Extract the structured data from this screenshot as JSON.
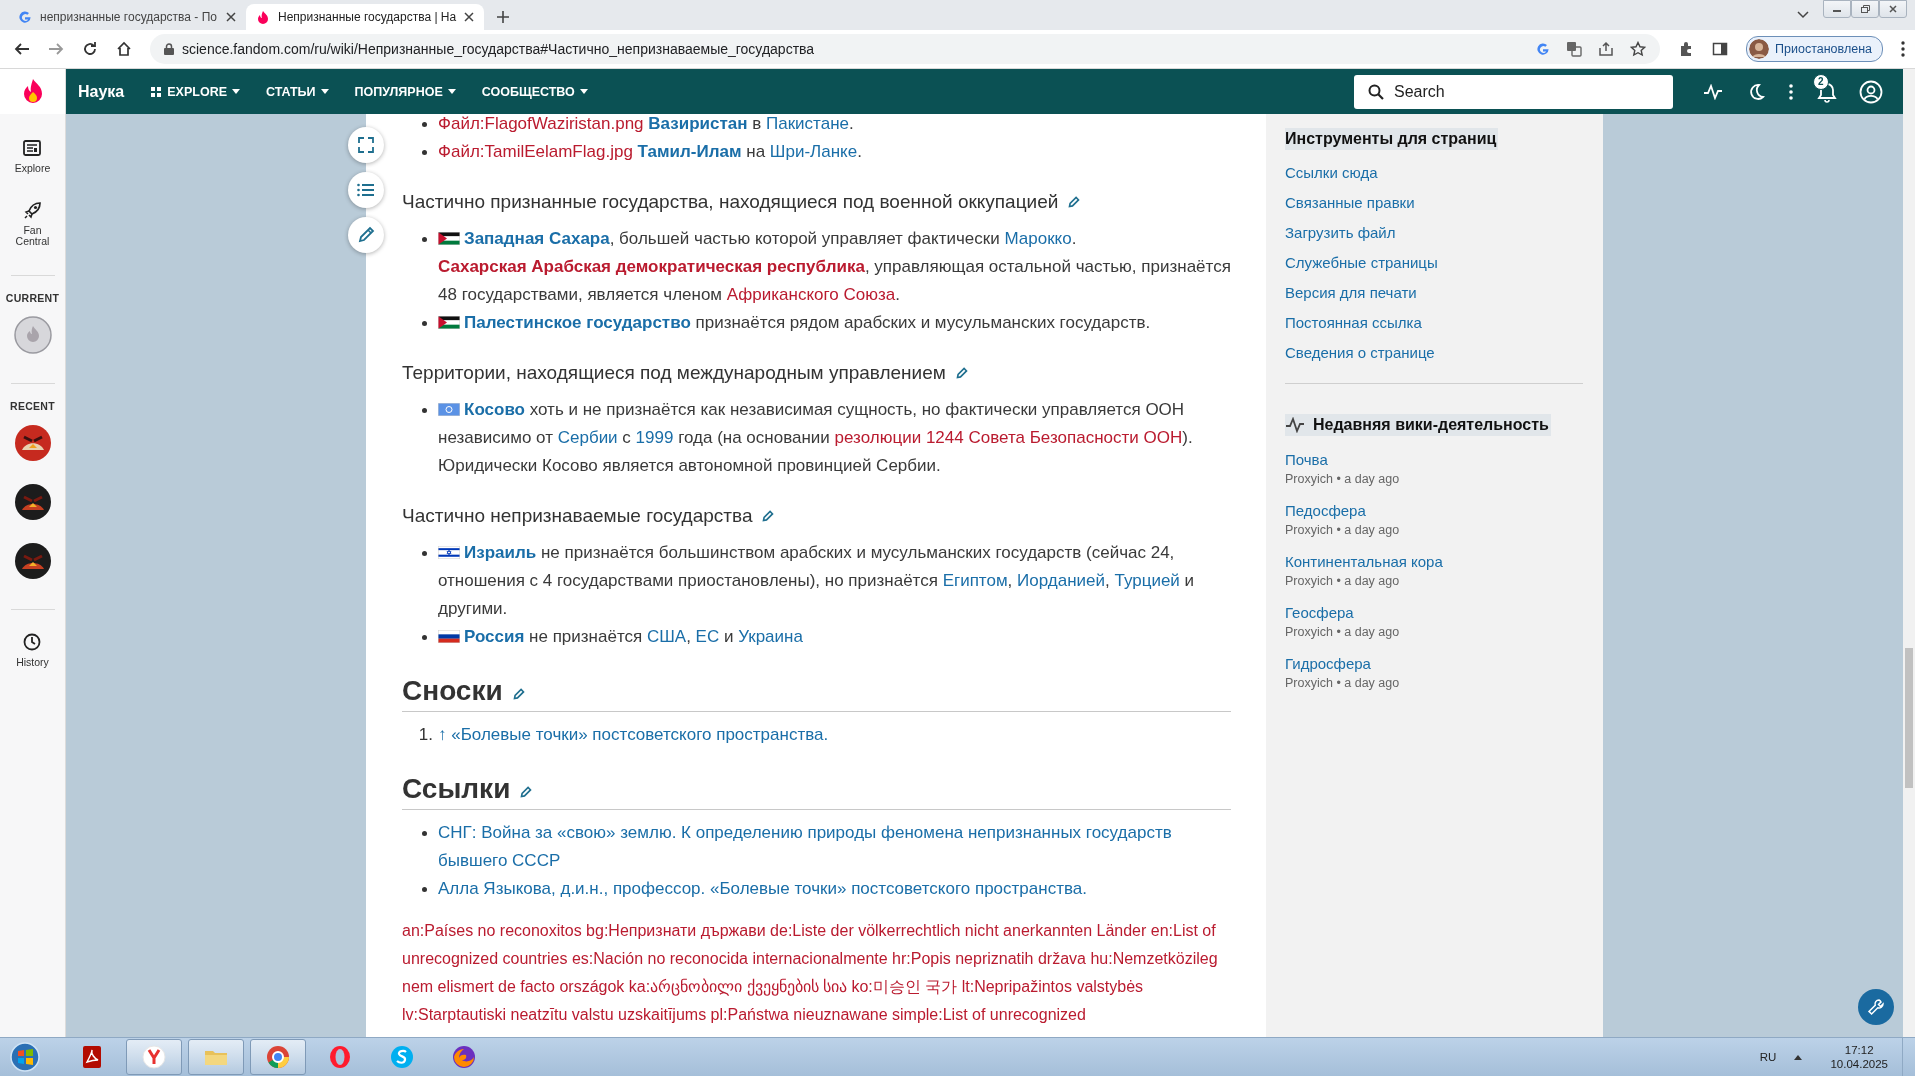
{
  "browser": {
    "tabs": [
      {
        "kind": "search",
        "title": "непризнанные государства - По",
        "selected": false
      },
      {
        "kind": "wiki",
        "title": "Непризнанные государства | На",
        "selected": true
      }
    ],
    "address": "science.fandom.com/ru/wiki/Непризнанные_государства#Частично_непризнаваемые_государства",
    "profile": "Приостановлена"
  },
  "navbar": {
    "wiki_name": "Наука",
    "menus": [
      {
        "label": "EXPLORE",
        "kind": "icon"
      },
      {
        "label": "СТАТЬИ",
        "kind": "plain"
      },
      {
        "label": "ПОПУЛЯРНОЕ",
        "kind": "plain"
      },
      {
        "label": "СООБЩЕСТВО",
        "kind": "plain"
      }
    ],
    "search": {
      "placeholder": "Search"
    },
    "notifications": "2"
  },
  "rail": {
    "explore": "Explore",
    "fan_central": "Fan Central",
    "current": "CURRENT",
    "recent": "RECENT",
    "history": "History"
  },
  "article": {
    "blocks": [
      {
        "kind": "list",
        "items": [
          {
            "runs": [
              {
                "kind": "redlink",
                "text": "Файл:FlagofWaziristan.png"
              },
              {
                "kind": "strong-link",
                "text": "Вазиристан",
                "space_before": true
              },
              {
                "kind": "text",
                "text": " в "
              },
              {
                "kind": "link",
                "text": "Пакистане"
              },
              {
                "kind": "text",
                "text": "."
              }
            ]
          },
          {
            "runs": [
              {
                "kind": "redlink",
                "text": "Файл:TamilEelamFlag.jpg"
              },
              {
                "kind": "strong-link",
                "text": "Тамил-Илам",
                "space_before": true
              },
              {
                "kind": "text",
                "text": " на "
              },
              {
                "kind": "link",
                "text": "Шри-Ланке"
              },
              {
                "kind": "text",
                "text": "."
              }
            ]
          }
        ]
      },
      {
        "kind": "h3",
        "text": "Частично признанные государства, находящиеся под военной оккупацией"
      },
      {
        "kind": "list",
        "items": [
          {
            "flag": {
              "kind": "tricolor-triangle"
            },
            "runs": [
              {
                "kind": "strong-link",
                "text": "Западная Сахара"
              },
              {
                "kind": "text",
                "text": ", большей частью которой управляет фактически "
              },
              {
                "kind": "link",
                "text": "Марокко"
              },
              {
                "kind": "text",
                "text": ". "
              },
              {
                "kind": "strong-redlink",
                "text": "Сахарская Арабская демократическая республика"
              },
              {
                "kind": "text",
                "text": ", управляющая остальной частью, признаётся 48 государствами, является членом "
              },
              {
                "kind": "redlink",
                "text": "Африканского Союза"
              },
              {
                "kind": "text",
                "text": "."
              }
            ]
          },
          {
            "flag": {
              "kind": "tricolor-triangle"
            },
            "runs": [
              {
                "kind": "strong-link",
                "text": "Палестинское государство"
              },
              {
                "kind": "text",
                "text": " признаётся рядом арабских и мусульманских государств."
              }
            ]
          }
        ]
      },
      {
        "kind": "h3",
        "text": "Территории, находящиеся под международным управлением"
      },
      {
        "kind": "list",
        "items": [
          {
            "flag": {
              "kind": "emblem"
            },
            "runs": [
              {
                "kind": "strong-link",
                "text": "Косово"
              },
              {
                "kind": "text",
                "text": " хоть и не признаётся как независимая сущность, но фактически управляется ООН независимо от "
              },
              {
                "kind": "link",
                "text": "Сербии"
              },
              {
                "kind": "text",
                "text": " с "
              },
              {
                "kind": "link",
                "text": "1999"
              },
              {
                "kind": "text",
                "text": " года (на основании "
              },
              {
                "kind": "redlink",
                "text": "резолюции 1244 Совета Безопасности ООН"
              },
              {
                "kind": "text",
                "text": "). Юридически Косово является автономной провинцией Сербии."
              }
            ]
          }
        ]
      },
      {
        "kind": "h3",
        "text": "Частично непризнаваемые государства"
      },
      {
        "kind": "list",
        "items": [
          {
            "flag": {
              "kind": "two-bands"
            },
            "runs": [
              {
                "kind": "strong-link",
                "text": "Израиль"
              },
              {
                "kind": "text",
                "text": " не признаётся большинством арабских и мусульманских государств (сейчас 24, отношения с 4 государствами приостановлены), но признаётся "
              },
              {
                "kind": "link",
                "text": "Египтом"
              },
              {
                "kind": "text",
                "text": ", "
              },
              {
                "kind": "link",
                "text": "Иорданией"
              },
              {
                "kind": "text",
                "text": ", "
              },
              {
                "kind": "link",
                "text": "Турцией"
              },
              {
                "kind": "text",
                "text": " и другими."
              }
            ]
          },
          {
            "flag": {
              "kind": "tricolor"
            },
            "runs": [
              {
                "kind": "strong-link",
                "text": "Россия"
              },
              {
                "kind": "text",
                "text": " не признаётся "
              },
              {
                "kind": "link",
                "text": "США"
              },
              {
                "kind": "text",
                "text": ", "
              },
              {
                "kind": "link",
                "text": "ЕС"
              },
              {
                "kind": "text",
                "text": " и "
              },
              {
                "kind": "link",
                "text": "Украина"
              }
            ]
          }
        ]
      },
      {
        "kind": "h2",
        "text": "Сноски"
      },
      {
        "kind": "olist",
        "items": [
          {
            "number": "1.",
            "runs": [
              {
                "kind": "link",
                "text": "↑"
              },
              {
                "kind": "link",
                "text": "«Болевые точки» постсоветского пространства.",
                "space_before": true
              }
            ]
          }
        ]
      },
      {
        "kind": "h2",
        "text": "Ссылки"
      },
      {
        "kind": "list",
        "items": [
          {
            "runs": [
              {
                "kind": "link",
                "text": "СНГ: Война за «свою» землю. К определению природы феномена непризнанных государств бывшего СССР"
              }
            ]
          },
          {
            "runs": [
              {
                "kind": "link",
                "text": "Алла Языкова, д.и.н., профессор. «Болевые точки» постсоветского пространства."
              }
            ]
          }
        ]
      },
      {
        "kind": "interwiki",
        "text": "an:Países no reconoxitos bg:Непризнати държави de:Liste der völkerrechtlich nicht anerkannten Länder en:List of unrecognized countries es:Nación no reconocida internacionalmente hr:Popis nepriznatih država hu:Nemzetközileg nem elismert de facto országok ka:არცნობილი ქვეყნების სია ko:미승인 국가 lt:Nepripažintos valstybės lv:Starptautiski neatzītu valstu uzskaitījums pl:Państwa nieuznawane simple:List of unrecognized"
      }
    ]
  },
  "sidebar": {
    "tools": {
      "title": "Инструменты для страниц",
      "links": [
        "Ссылки сюда",
        "Связанные правки",
        "Загрузить файл",
        "Служебные страницы",
        "Версия для печати",
        "Постоянная ссылка",
        "Сведения о странице"
      ]
    },
    "activity": {
      "title": "Недавняя вики-деятельность",
      "items": [
        {
          "title": "Почва",
          "meta": "Proxyich • a day ago"
        },
        {
          "title": "Педосфера",
          "meta": "Proxyich • a day ago"
        },
        {
          "title": "Континентальная кора",
          "meta": "Proxyich • a day ago"
        },
        {
          "title": "Геосфера",
          "meta": "Proxyich • a day ago"
        },
        {
          "title": "Гидросфера",
          "meta": "Proxyich • a day ago"
        }
      ]
    }
  },
  "taskbar": {
    "apps": [
      {
        "kind": "document",
        "running": false
      },
      {
        "kind": "letter-browser",
        "running": true
      },
      {
        "kind": "folder",
        "running": true
      },
      {
        "kind": "chrome",
        "running": true
      },
      {
        "kind": "ring",
        "running": false
      },
      {
        "kind": "chat",
        "running": false
      },
      {
        "kind": "fox",
        "running": false
      }
    ],
    "language": "RU",
    "time": "17:12",
    "date": "10.04.2025"
  }
}
